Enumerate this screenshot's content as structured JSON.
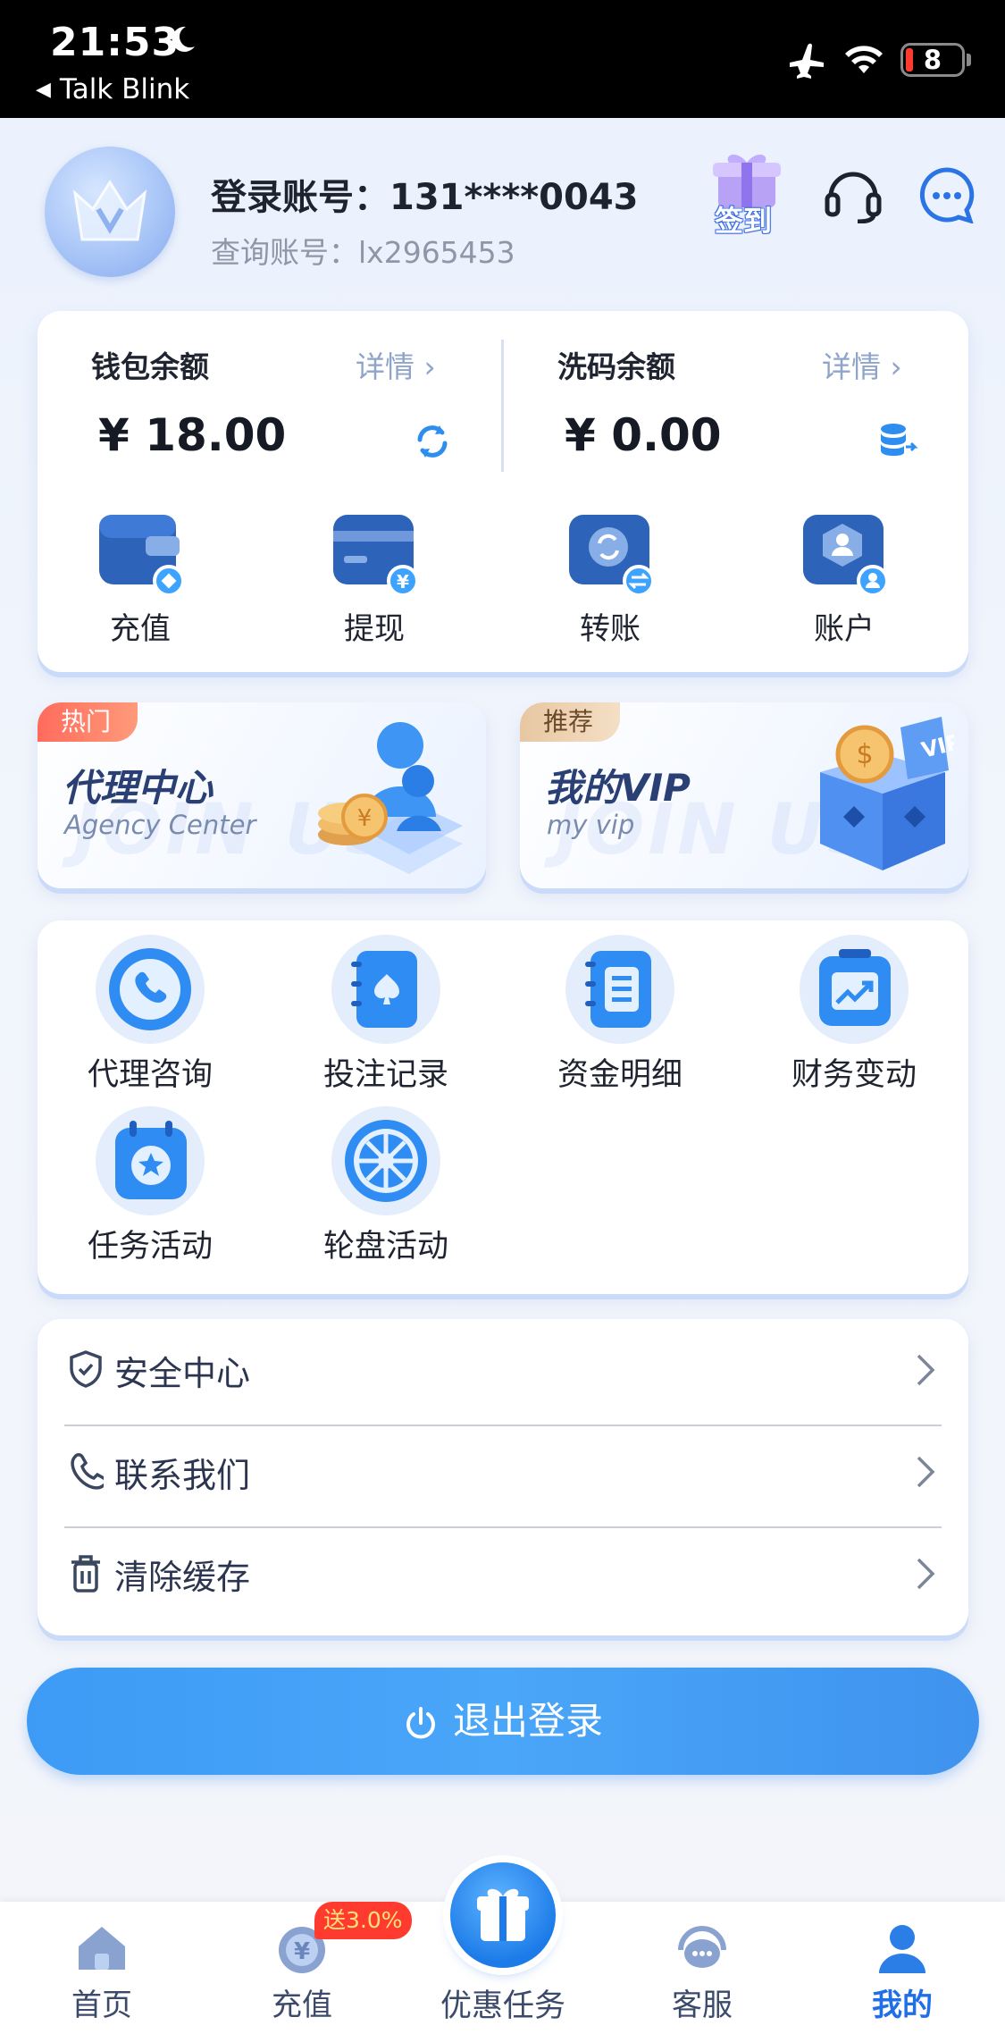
{
  "status_bar": {
    "time": "21:53",
    "back_app": "Talk Blink",
    "battery": "8"
  },
  "header": {
    "account_label": "登录账号：131****0043",
    "query_account": "查询账号：lx2965453",
    "sign_in_label": "签到"
  },
  "wallet": {
    "left": {
      "title": "钱包余额",
      "detail": "详情 ›",
      "amount": "¥ 18.00"
    },
    "right": {
      "title": "洗码余额",
      "detail": "详情 ›",
      "amount": "¥ 0.00"
    },
    "actions": [
      {
        "label": "充值",
        "icon": "wallet-icon"
      },
      {
        "label": "提现",
        "icon": "card-icon"
      },
      {
        "label": "转账",
        "icon": "transfer-icon"
      },
      {
        "label": "账户",
        "icon": "account-icon"
      }
    ]
  },
  "promos": [
    {
      "tag": "热门",
      "title": "代理中心",
      "subtitle": "Agency Center",
      "watermark": "JOIN US"
    },
    {
      "tag": "推荐",
      "title": "我的VIP",
      "subtitle": "my vip",
      "watermark": "JOIN US"
    }
  ],
  "grid": [
    {
      "label": "代理咨询",
      "icon": "phone-icon"
    },
    {
      "label": "投注记录",
      "icon": "notebook-icon"
    },
    {
      "label": "资金明细",
      "icon": "ledger-icon"
    },
    {
      "label": "财务变动",
      "icon": "chart-icon"
    },
    {
      "label": "任务活动",
      "icon": "calendar-star-icon"
    },
    {
      "label": "轮盘活动",
      "icon": "wheel-icon"
    }
  ],
  "list": [
    {
      "label": "安全中心",
      "icon": "shield-icon"
    },
    {
      "label": "联系我们",
      "icon": "phone-outline-icon"
    },
    {
      "label": "清除缓存",
      "icon": "trash-icon"
    }
  ],
  "logout_label": "退出登录",
  "tabbar": {
    "tabs": [
      {
        "label": "首页",
        "icon": "home-icon"
      },
      {
        "label": "充值",
        "icon": "recharge-icon"
      },
      {
        "label": "优惠任务",
        "icon": "gift-icon"
      },
      {
        "label": "客服",
        "icon": "support-icon"
      },
      {
        "label": "我的",
        "icon": "user-icon"
      }
    ],
    "badge": "送3.0%",
    "active": "我的"
  },
  "colors": {
    "accent": "#1f6fe8",
    "button": "#3d9bf6",
    "hot_tag": "#ff6b5c"
  }
}
